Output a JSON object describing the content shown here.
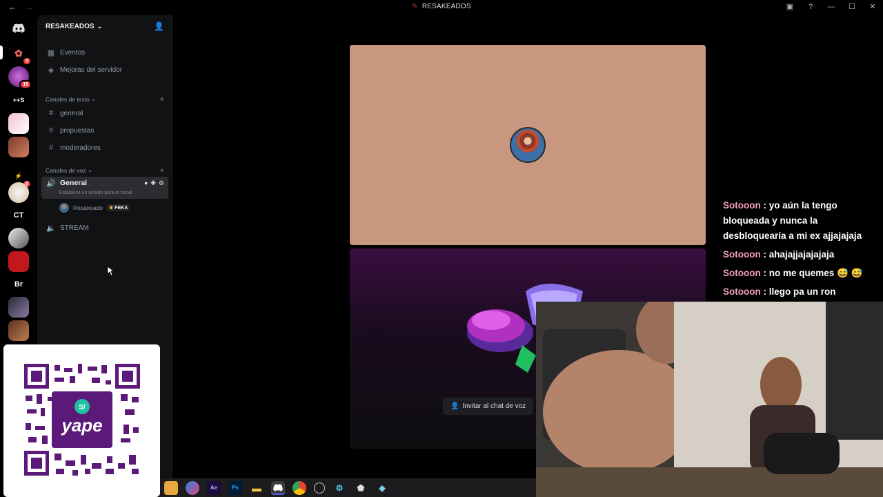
{
  "titlebar": {
    "title": "RESAKEADOS",
    "back": "←",
    "forward": "→"
  },
  "rail": {
    "items": [
      {
        "icon": "discord-icon",
        "text": ""
      },
      {
        "icon": "server-avatar",
        "text": "",
        "badge": "4"
      },
      {
        "icon": "server-avatar",
        "text": "",
        "badge": "18"
      },
      {
        "icon": "server-text",
        "text": "++S"
      },
      {
        "icon": "server-avatar",
        "text": ""
      },
      {
        "icon": "server-avatar",
        "text": ""
      },
      {
        "icon": "server-avatar",
        "text": "",
        "badge": "8"
      },
      {
        "icon": "server-avatar",
        "text": ""
      },
      {
        "icon": "server-text",
        "text": "CT"
      },
      {
        "icon": "server-avatar",
        "text": ""
      },
      {
        "icon": "server-avatar",
        "text": ""
      },
      {
        "icon": "server-text",
        "text": "Br"
      },
      {
        "icon": "server-avatar",
        "text": ""
      },
      {
        "icon": "server-avatar",
        "text": ""
      }
    ]
  },
  "sidebar": {
    "server_name": "RESAKEADOS",
    "events_label": "Eventos",
    "boosts_label": "Mejoras del servidor",
    "text_category": "Canales de texto",
    "text_channels": [
      "general",
      "propuestas",
      "moderadores"
    ],
    "voice_category": "Canales de voz",
    "voice_active_channel": "General",
    "voice_status_placeholder": "Establece un estado para el canal",
    "voice_member_name": "Resakeado",
    "voice_member_tag": "FEKA",
    "voice_other_channel": "STREAM"
  },
  "stage": {
    "invite_button_label": "Invitar al chat de voz"
  },
  "chat": {
    "messages": [
      {
        "user": "Sotooon",
        "text": ": yo aún la tengo bloqueada y nunca la desbloquearía a mi ex ajjajajaja"
      },
      {
        "user": "Sotooon",
        "text": ": ahajajjajajajaja"
      },
      {
        "user": "Sotooon",
        "text": ": no me quemes 😅 😅"
      },
      {
        "user": "Sotooon",
        "text": ": llego pa un ron"
      }
    ]
  },
  "qr": {
    "brand": "yape",
    "currency": "S/"
  },
  "taskbar": {
    "apps": [
      "Ae",
      "Ps"
    ]
  }
}
